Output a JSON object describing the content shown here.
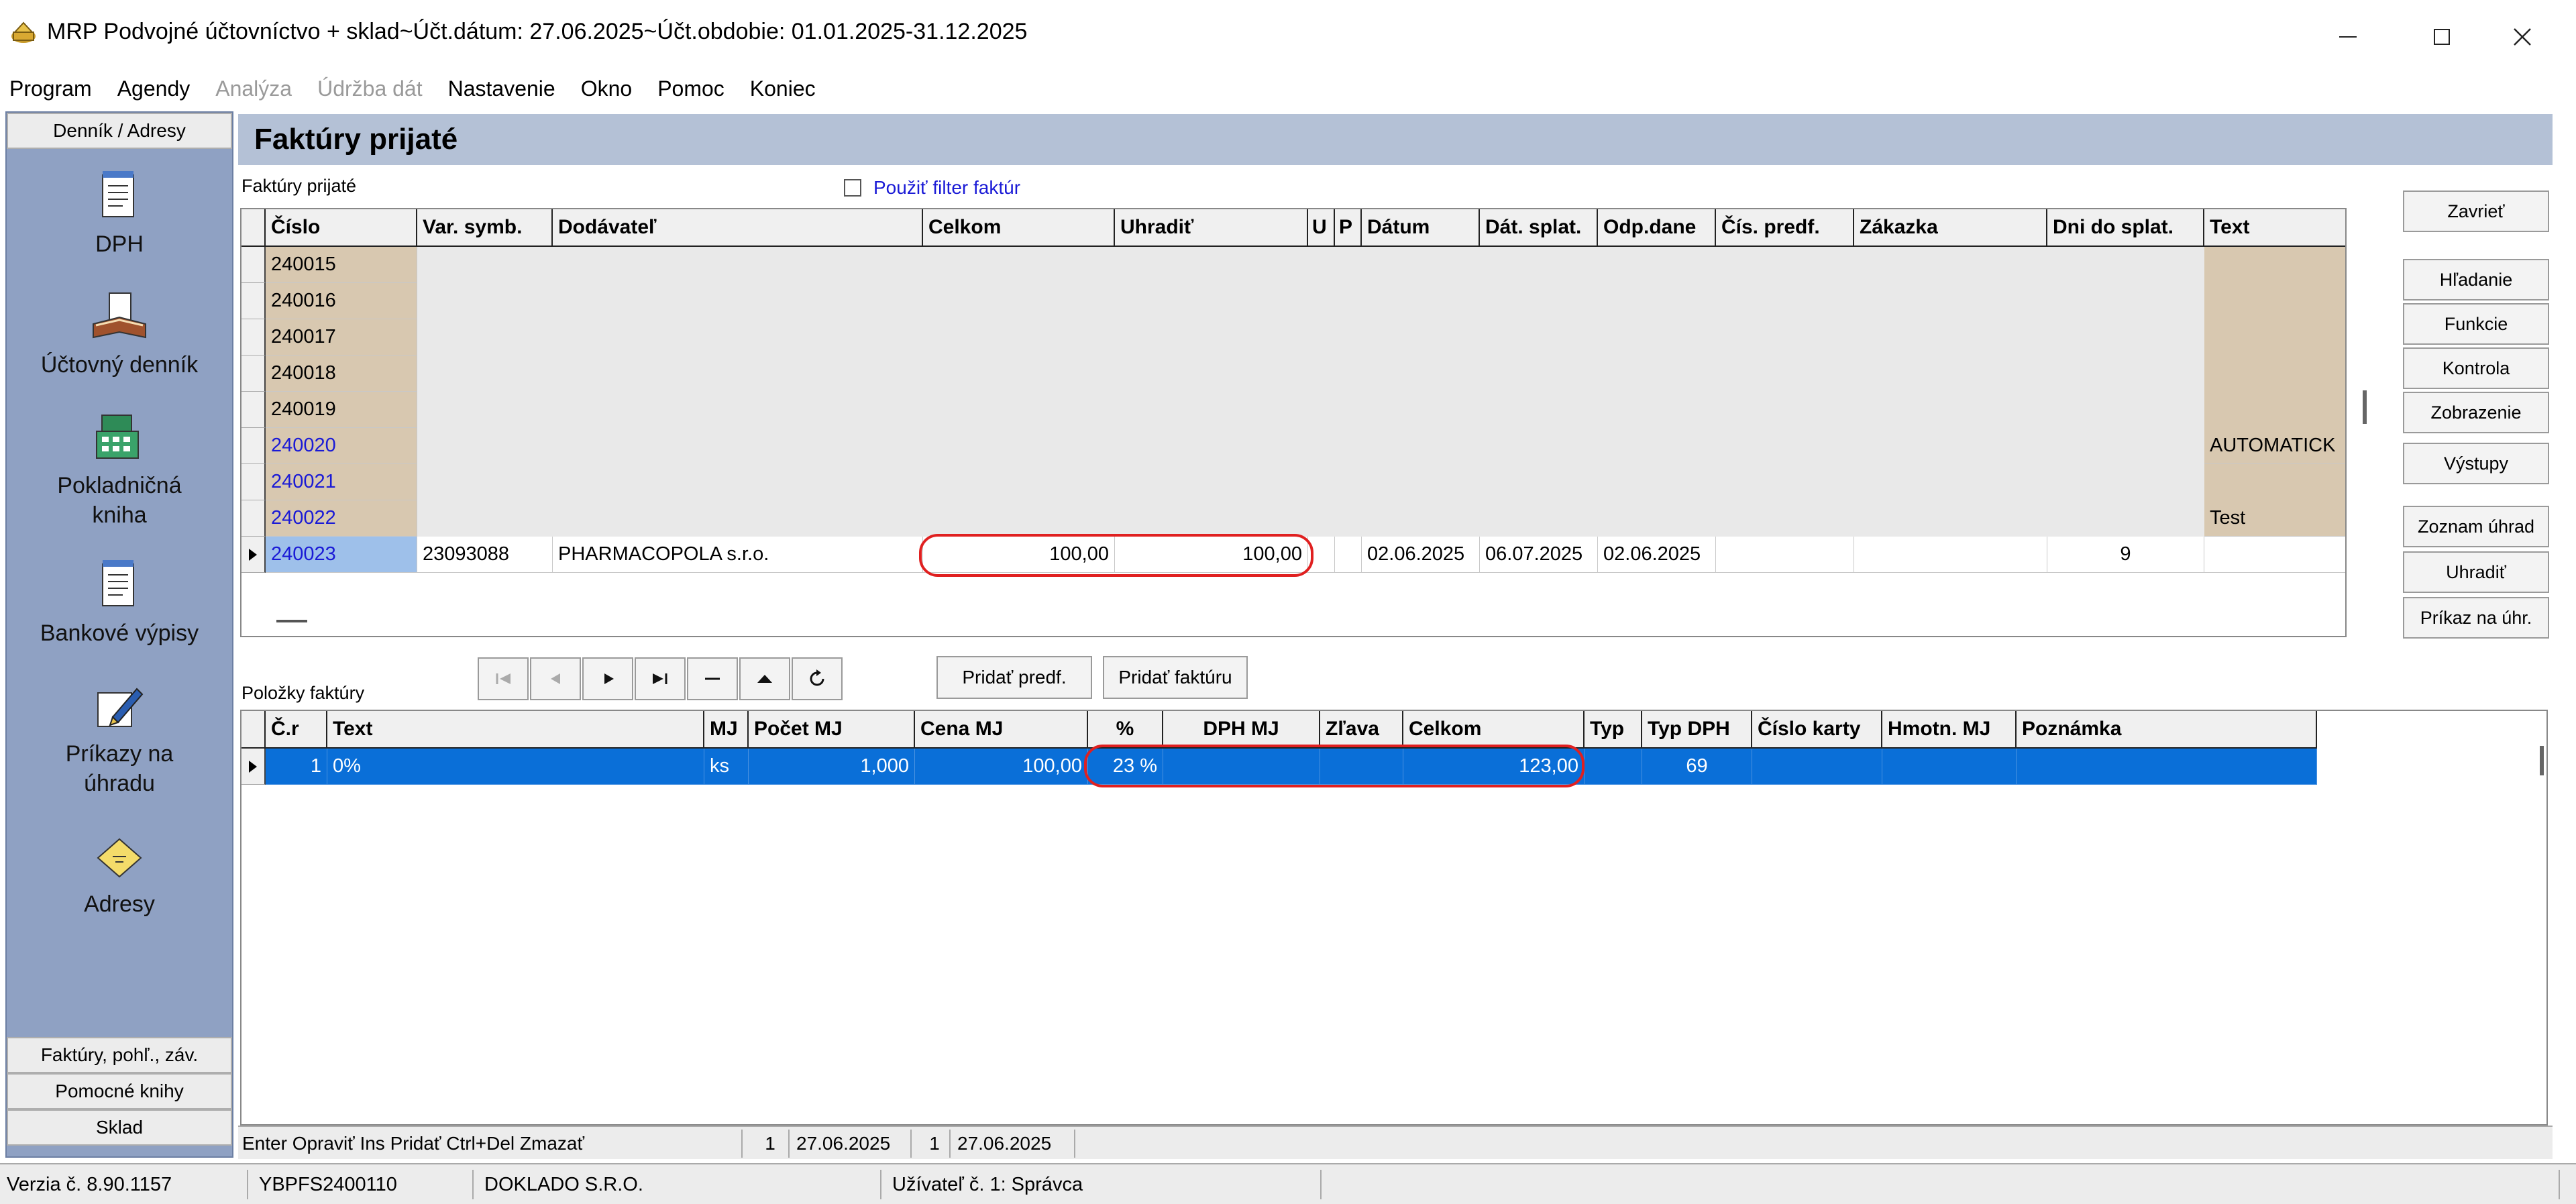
{
  "window": {
    "title": "MRP Podvojné účtovníctvo + sklad~Účt.dátum: 27.06.2025~Účt.obdobie: 01.01.2025-31.12.2025",
    "minimize_icon": "minimize-icon",
    "maximize_icon": "maximize-icon",
    "close_icon": "close-icon"
  },
  "menu": [
    "Program",
    "Agendy",
    "Analýza",
    "Údržba dát",
    "Nastavenie",
    "Okno",
    "Pomoc",
    "Koniec"
  ],
  "menu_disabled": [
    "Analýza",
    "Údržba dát"
  ],
  "leftnav": {
    "top_tab": "Denník / Adresy",
    "items": [
      {
        "label": "DPH",
        "icon": "notepad-icon"
      },
      {
        "label": "Účtovný denník",
        "icon": "book-icon"
      },
      {
        "label": "Pokladničná\nkniha",
        "icon": "cash-register-icon"
      },
      {
        "label": "Bankové výpisy",
        "icon": "notepad-icon"
      },
      {
        "label": "Príkazy na\núhradu",
        "icon": "pen-icon"
      },
      {
        "label": "Adresy",
        "icon": "address-card-icon"
      }
    ],
    "bottom_tabs": [
      "Faktúry, pohľ., záv.",
      "Pomocné knihy",
      "Sklad"
    ]
  },
  "header": {
    "title": "Faktúry prijaté"
  },
  "upper": {
    "section_label": "Faktúry prijaté",
    "filter_label": "Použiť filter faktúr",
    "filter_checked": false,
    "columns": [
      "Číslo",
      "Var. symb.",
      "Dodávateľ",
      "Celkom",
      "Uhradiť",
      "U",
      "P",
      "Dátum",
      "Dát. splat.",
      "Odp.dane",
      "Čís. predf.",
      "Zákazka",
      "Dni do splat.",
      "Text"
    ],
    "rows": [
      {
        "cislo": "240015",
        "text": "",
        "blue": false
      },
      {
        "cislo": "240016",
        "text": "",
        "blue": false
      },
      {
        "cislo": "240017",
        "text": "",
        "blue": false
      },
      {
        "cislo": "240018",
        "text": "",
        "blue": false
      },
      {
        "cislo": "240019",
        "text": "",
        "blue": false
      },
      {
        "cislo": "240020",
        "text": "AUTOMATICK",
        "blue": true
      },
      {
        "cislo": "240021",
        "text": "",
        "blue": true
      },
      {
        "cislo": "240022",
        "text": "Test",
        "blue": true
      }
    ],
    "current_row": {
      "cislo": "240023",
      "var_symb": "23093088",
      "dodavatel": "PHARMACOPOLA s.r.o.",
      "celkom": "100,00",
      "uhradit": "100,00",
      "u": "",
      "p": "",
      "datum": "02.06.2025",
      "dat_splat": "06.07.2025",
      "odp_dane": "02.06.2025",
      "cis_predf": "",
      "zakazka": "",
      "dni_do_splat": "9",
      "text": ""
    }
  },
  "right_buttons": [
    "Zavrieť",
    "Hľadanie",
    "Funkcie",
    "Kontrola",
    "Zobrazenie",
    "Výstupy",
    "Zoznam úhrad",
    "Uhradiť",
    "Príkaz na úhr."
  ],
  "lower": {
    "section_label": "Položky faktúry",
    "nav_buttons": [
      {
        "name": "first-record-icon",
        "glyph": "⏮"
      },
      {
        "name": "prev-record-icon",
        "glyph": "◀"
      },
      {
        "name": "next-record-icon",
        "glyph": "▶"
      },
      {
        "name": "last-record-icon",
        "glyph": "⏭"
      },
      {
        "name": "delete-record-icon",
        "glyph": "—"
      },
      {
        "name": "up-icon",
        "glyph": "▲"
      },
      {
        "name": "refresh-icon",
        "glyph": "↻"
      }
    ],
    "add_predf_label": "Pridať predf.",
    "add_invoice_label": "Pridať faktúru",
    "columns": [
      "Č.r",
      "Text",
      "MJ",
      "Počet MJ",
      "Cena MJ",
      "%",
      "DPH MJ",
      "Zľava",
      "Celkom",
      "Typ",
      "Typ DPH",
      "Číslo karty",
      "Hmotn. MJ",
      "Poznámka"
    ],
    "row": {
      "cr": "1",
      "text": "0%",
      "mj": "ks",
      "pocet": "1,000",
      "cena": "100,00",
      "pct": "23 %",
      "dph_mj": "",
      "zlava": "",
      "celkom": "123,00",
      "typ": "",
      "typ_dph": "69",
      "cislo_karty": "",
      "hmotn": "",
      "poznamka": ""
    }
  },
  "statusbar": {
    "shortcuts": "Enter Opraviť  Ins Pridať  Ctrl+Del Zmazať",
    "seg1": "1",
    "date1": "27.06.2025",
    "seg2": "1",
    "date2": "27.06.2025"
  },
  "bottombar": {
    "version": "Verzia č. 8.90.1157",
    "license": "YBPFS2400110",
    "company": "DOKLADO S.R.O.",
    "user": "Užívateľ č. 1: Správca"
  },
  "colors": {
    "selection": "#0a6fd8",
    "highlight": "#e02020",
    "nav_bg": "#8fa1c3",
    "tan": "#d8c8b0"
  }
}
